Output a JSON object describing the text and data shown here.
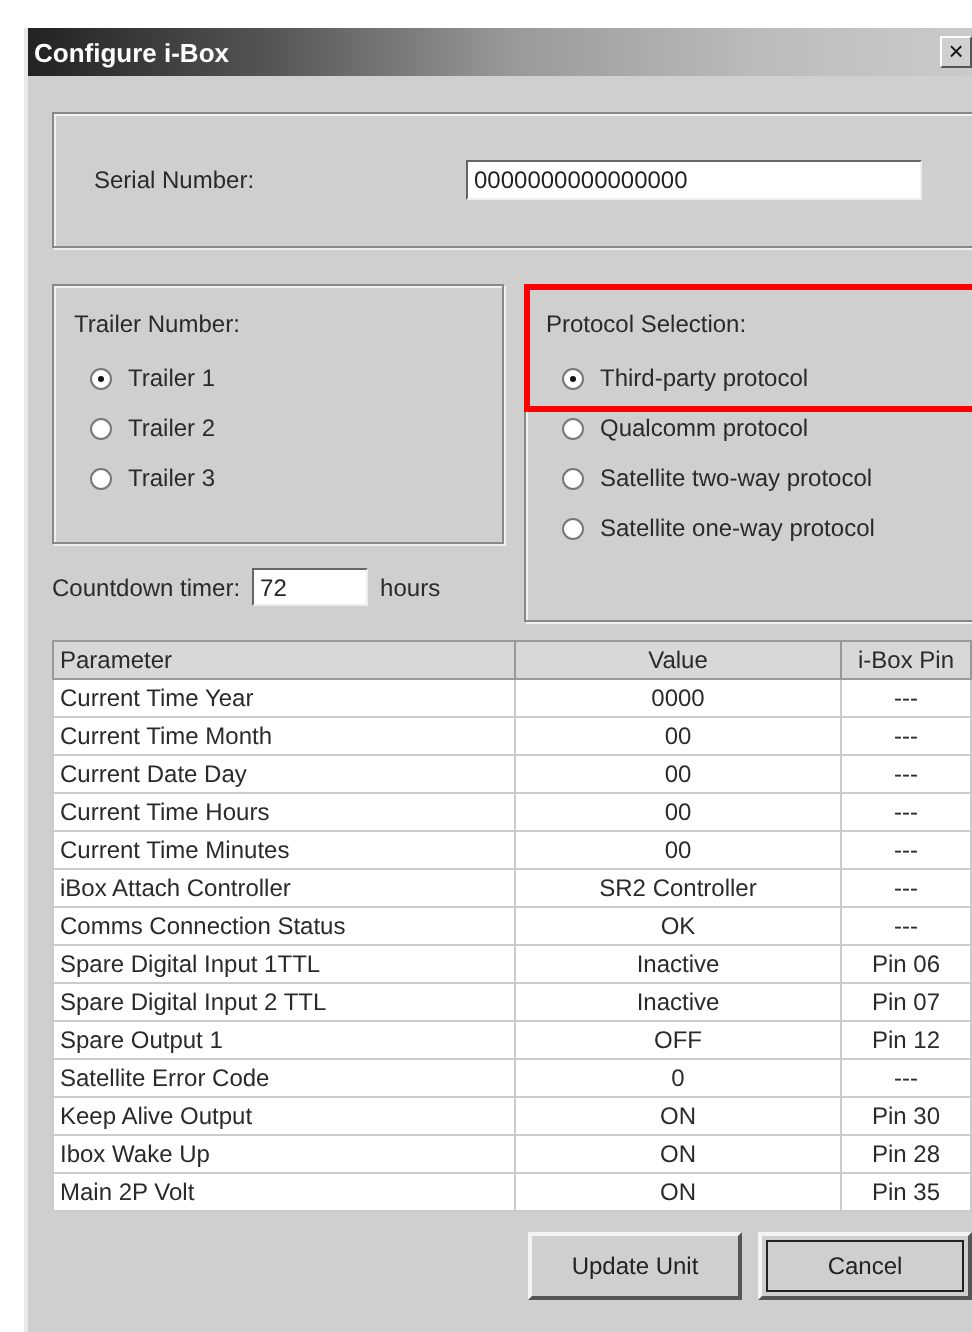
{
  "window": {
    "title": "Configure i-Box",
    "close": "×"
  },
  "serial": {
    "label": "Serial Number:",
    "value": "0000000000000000"
  },
  "trailer": {
    "label": "Trailer Number:",
    "options": [
      {
        "label": "Trailer 1",
        "selected": true
      },
      {
        "label": "Trailer 2",
        "selected": false
      },
      {
        "label": "Trailer 3",
        "selected": false
      }
    ]
  },
  "protocol": {
    "label": "Protocol Selection:",
    "highlighted": true,
    "options": [
      {
        "label": "Third-party protocol",
        "selected": true
      },
      {
        "label": "Qualcomm protocol",
        "selected": false
      },
      {
        "label": "Satellite two-way protocol",
        "selected": false
      },
      {
        "label": "Satellite one-way protocol",
        "selected": false
      }
    ]
  },
  "countdown": {
    "label": "Countdown timer:",
    "value": "72",
    "unit": "hours"
  },
  "table": {
    "columns": [
      "Parameter",
      "Value",
      "i-Box Pin"
    ],
    "rows": [
      [
        "Current Time Year",
        "0000",
        "---"
      ],
      [
        "Current Time Month",
        "00",
        "---"
      ],
      [
        "Current Date Day",
        "00",
        "---"
      ],
      [
        "Current Time Hours",
        "00",
        "---"
      ],
      [
        "Current Time Minutes",
        "00",
        "---"
      ],
      [
        "iBox Attach Controller",
        "SR2 Controller",
        "---"
      ],
      [
        "Comms Connection Status",
        "OK",
        "---"
      ],
      [
        "Spare Digital Input 1TTL",
        "Inactive",
        "Pin 06"
      ],
      [
        "Spare Digital Input 2 TTL",
        "Inactive",
        "Pin 07"
      ],
      [
        "Spare Output 1",
        "OFF",
        "Pin 12"
      ],
      [
        "Satellite Error Code",
        "0",
        "---"
      ],
      [
        "Keep Alive Output",
        "ON",
        "Pin 30"
      ],
      [
        "Ibox Wake Up",
        "ON",
        "Pin 28"
      ],
      [
        "Main 2P Volt",
        "ON",
        "Pin 35"
      ]
    ]
  },
  "buttons": [
    {
      "label": "Update Unit",
      "default": false
    },
    {
      "label": "Cancel",
      "default": true
    }
  ]
}
